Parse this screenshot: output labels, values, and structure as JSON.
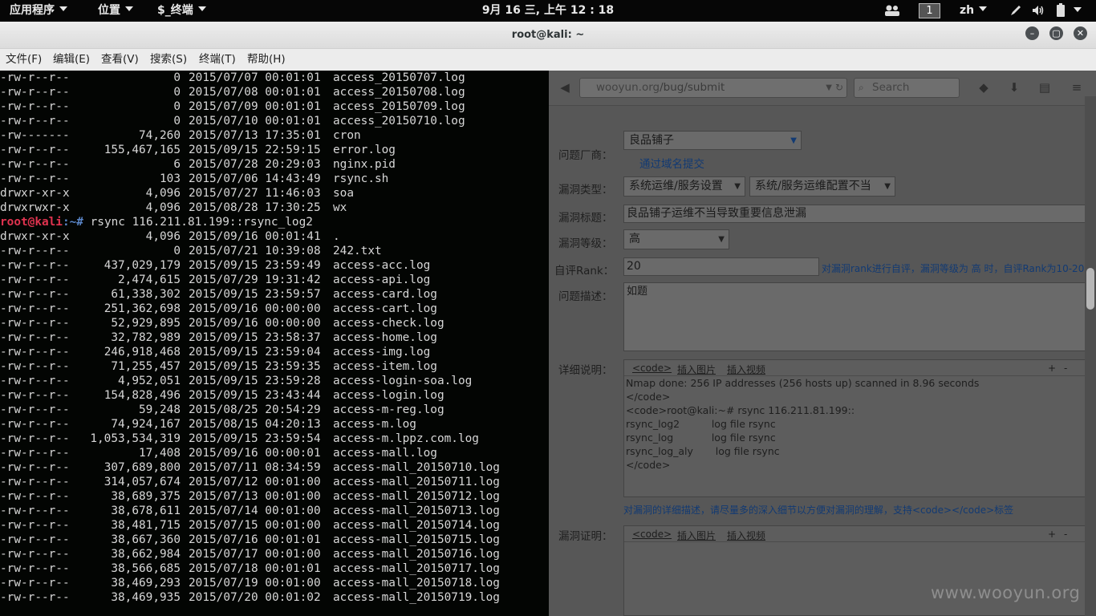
{
  "panel": {
    "apps": "应用程序",
    "places": "位置",
    "terminal_app": "$_终端",
    "clock": "9月 16 三, 上午 12 : 18",
    "workspace": "1",
    "lang": "zh"
  },
  "window": {
    "title": "root@kali: ~",
    "menu": [
      "文件(F)",
      "编辑(E)",
      "查看(V)",
      "搜索(S)",
      "终端(T)",
      "帮助(H)"
    ]
  },
  "terminal": {
    "lines_top": [
      {
        "perm": "-rw-r--r--",
        "size": "0",
        "date": "2015/07/07 00:01:01",
        "name": "access_20150707.log"
      },
      {
        "perm": "-rw-r--r--",
        "size": "0",
        "date": "2015/07/08 00:01:01",
        "name": "access_20150708.log"
      },
      {
        "perm": "-rw-r--r--",
        "size": "0",
        "date": "2015/07/09 00:01:01",
        "name": "access_20150709.log"
      },
      {
        "perm": "-rw-r--r--",
        "size": "0",
        "date": "2015/07/10 00:01:01",
        "name": "access_20150710.log"
      },
      {
        "perm": "-rw-------",
        "size": "74,260",
        "date": "2015/07/13 17:35:01",
        "name": "cron"
      },
      {
        "perm": "-rw-r--r--",
        "size": "155,467,165",
        "date": "2015/09/15 22:59:15",
        "name": "error.log"
      },
      {
        "perm": "-rw-r--r--",
        "size": "6",
        "date": "2015/07/28 20:29:03",
        "name": "nginx.pid"
      },
      {
        "perm": "-rw-r--r--",
        "size": "103",
        "date": "2015/07/06 14:43:49",
        "name": "rsync.sh"
      },
      {
        "perm": "drwxr-xr-x",
        "size": "4,096",
        "date": "2015/07/27 11:46:03",
        "name": "soa"
      },
      {
        "perm": "drwxrwxr-x",
        "size": "4,096",
        "date": "2015/08/28 17:30:25",
        "name": "wx"
      }
    ],
    "prompt_user": "root@kali",
    "prompt_path": ":~#",
    "command": " rsync 116.211.81.199::rsync_log2",
    "lines_bottom": [
      {
        "perm": "drwxr-xr-x",
        "size": "4,096",
        "date": "2015/09/16 00:01:41",
        "name": "."
      },
      {
        "perm": "-rw-r--r--",
        "size": "0",
        "date": "2015/07/21 10:39:08",
        "name": "242.txt"
      },
      {
        "perm": "-rw-r--r--",
        "size": "437,029,179",
        "date": "2015/09/15 23:59:49",
        "name": "access-acc.log"
      },
      {
        "perm": "-rw-r--r--",
        "size": "2,474,615",
        "date": "2015/07/29 19:31:42",
        "name": "access-api.log"
      },
      {
        "perm": "-rw-r--r--",
        "size": "61,338,302",
        "date": "2015/09/15 23:59:57",
        "name": "access-card.log"
      },
      {
        "perm": "-rw-r--r--",
        "size": "251,362,698",
        "date": "2015/09/16 00:00:00",
        "name": "access-cart.log"
      },
      {
        "perm": "-rw-r--r--",
        "size": "52,929,895",
        "date": "2015/09/16 00:00:00",
        "name": "access-check.log"
      },
      {
        "perm": "-rw-r--r--",
        "size": "32,782,989",
        "date": "2015/09/15 23:58:37",
        "name": "access-home.log"
      },
      {
        "perm": "-rw-r--r--",
        "size": "246,918,468",
        "date": "2015/09/15 23:59:04",
        "name": "access-img.log"
      },
      {
        "perm": "-rw-r--r--",
        "size": "71,255,457",
        "date": "2015/09/15 23:59:35",
        "name": "access-item.log"
      },
      {
        "perm": "-rw-r--r--",
        "size": "4,952,051",
        "date": "2015/09/15 23:59:28",
        "name": "access-login-soa.log"
      },
      {
        "perm": "-rw-r--r--",
        "size": "154,828,496",
        "date": "2015/09/15 23:43:44",
        "name": "access-login.log"
      },
      {
        "perm": "-rw-r--r--",
        "size": "59,248",
        "date": "2015/08/25 20:54:29",
        "name": "access-m-reg.log"
      },
      {
        "perm": "-rw-r--r--",
        "size": "74,924,167",
        "date": "2015/08/15 04:20:13",
        "name": "access-m.log"
      },
      {
        "perm": "-rw-r--r--",
        "size": "1,053,534,319",
        "date": "2015/09/15 23:59:54",
        "name": "access-m.lppz.com.log"
      },
      {
        "perm": "-rw-r--r--",
        "size": "17,408",
        "date": "2015/09/16 00:00:01",
        "name": "access-mall.log"
      },
      {
        "perm": "-rw-r--r--",
        "size": "307,689,800",
        "date": "2015/07/11 08:34:59",
        "name": "access-mall_20150710.log"
      },
      {
        "perm": "-rw-r--r--",
        "size": "314,057,674",
        "date": "2015/07/12 00:01:00",
        "name": "access-mall_20150711.log"
      },
      {
        "perm": "-rw-r--r--",
        "size": "38,689,375",
        "date": "2015/07/13 00:01:00",
        "name": "access-mall_20150712.log"
      },
      {
        "perm": "-rw-r--r--",
        "size": "38,678,611",
        "date": "2015/07/14 00:01:00",
        "name": "access-mall_20150713.log"
      },
      {
        "perm": "-rw-r--r--",
        "size": "38,481,715",
        "date": "2015/07/15 00:01:00",
        "name": "access-mall_20150714.log"
      },
      {
        "perm": "-rw-r--r--",
        "size": "38,667,360",
        "date": "2015/07/16 00:01:01",
        "name": "access-mall_20150715.log"
      },
      {
        "perm": "-rw-r--r--",
        "size": "38,662,984",
        "date": "2015/07/17 00:01:00",
        "name": "access-mall_20150716.log"
      },
      {
        "perm": "-rw-r--r--",
        "size": "38,566,685",
        "date": "2015/07/18 00:01:01",
        "name": "access-mall_20150717.log"
      },
      {
        "perm": "-rw-r--r--",
        "size": "38,469,293",
        "date": "2015/07/19 00:01:00",
        "name": "access-mall_20150718.log"
      },
      {
        "perm": "-rw-r--r--",
        "size": "38,469,935",
        "date": "2015/07/20 00:01:02",
        "name": "access-mall_20150719.log"
      }
    ]
  },
  "browser": {
    "url_domain": "wooyun.org",
    "url_path": "/bug/submit",
    "search_placeholder": "Search",
    "form": {
      "vendor_label": "问题厂商：",
      "vendor_value": "良品铺子",
      "domain_link": "通过域名提交",
      "type_label": "漏洞类型：",
      "type_value1": "系统运维/服务设置",
      "type_value2": "系统/服务运维配置不当",
      "title_label": "漏洞标题：",
      "title_value": "良品铺子运维不当导致重要信息泄漏",
      "level_label": "漏洞等级：",
      "level_value": "高",
      "rank_label": "自评Rank：",
      "rank_value": "20",
      "rank_note": "对漏洞rank进行自评，漏洞等级为 高 时，自评Rank为10-20！",
      "desc_label": "问题描述：",
      "desc_value": "如题",
      "detail_label": "详细说明：",
      "editor_code": "<code>",
      "editor_img": "插入图片",
      "editor_video": "插入视频",
      "detail_lines": [
        "Nmap done: 256 IP addresses (256 hosts up) scanned in 8.96 seconds",
        "</code>",
        "<code>root@kali:~# rsync 116.211.81.199::",
        "rsync_log2          log file rsync",
        "rsync_log            log file rsync",
        "rsync_log_aly       log file rsync",
        "</code>"
      ],
      "detail_note": "对漏洞的详细描述，请尽量多的深入细节以方便对漏洞的理解，支持<code></code>标签",
      "proof_label": "漏洞证明："
    }
  },
  "watermark": "www.wooyun.org"
}
